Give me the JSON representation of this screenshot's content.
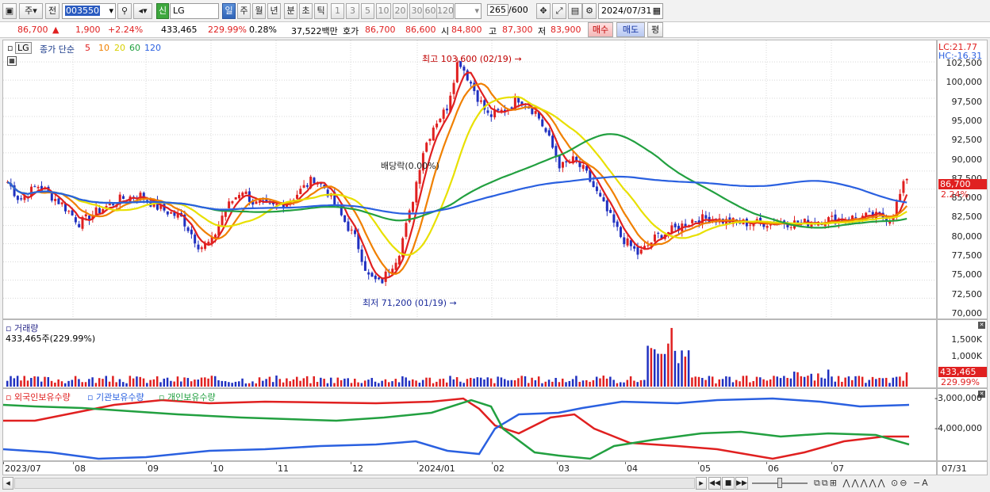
{
  "toolbar": {
    "period_label": "주",
    "prev_label": "전",
    "code_value": "003550",
    "stock_badge": "신",
    "name_value": "LG",
    "periods": [
      "일",
      "주",
      "월",
      "년",
      "분",
      "초",
      "틱"
    ],
    "counts": [
      "1",
      "3",
      "5",
      "10",
      "20",
      "30",
      "60",
      "120"
    ],
    "count_value": "265",
    "count_total": "/600",
    "date_value": "2024/07/31"
  },
  "info": {
    "price": "86,700",
    "change_arrow": "▲",
    "change": "1,900",
    "change_pct": "+2.24%",
    "volume": "433,465",
    "volume_ratio": "229.99%",
    "turnover": "0.28%",
    "amount": "37,522백만",
    "ask_label": "호가",
    "ask": "86,700",
    "bid": "86,600",
    "open_label": "시",
    "open": "84,800",
    "high_label": "고",
    "high": "87,300",
    "low_label": "저",
    "low": "83,900",
    "buy_btn": "매수",
    "sell_btn": "매도",
    "eval_btn": "평"
  },
  "price_panel": {
    "tag": "LG",
    "legend_title": "종가 단순",
    "ma_periods": [
      "5",
      "10",
      "20",
      "60",
      "120"
    ],
    "ma_colors": [
      "#e02020",
      "#f08000",
      "#e8e000",
      "#22a040",
      "#2a60e0"
    ],
    "lc": "LC:21.77",
    "hc": "HC:-16.31",
    "last_price_tag": "86,700",
    "last_pct_tag": "2.24%",
    "annot_high": "최고 103,600 (02/19)",
    "annot_low": "최저 71,200 (01/19)",
    "annot_div": "배당락(0.00%)",
    "y_ticks": [
      "102,500",
      "100,000",
      "97,500",
      "95,000",
      "92,500",
      "90,000",
      "87,500",
      "85,000",
      "82,500",
      "80,000",
      "77,500",
      "75,000",
      "72,500",
      "70,000"
    ]
  },
  "volume_panel": {
    "title": "거래량",
    "value": "433,465주(229.99%)",
    "y_ticks": [
      "1,500K",
      "1,000K"
    ],
    "last_tag": "433,465",
    "last_pct": "229.99%"
  },
  "holdings_panel": {
    "legends": [
      "외국인보유수량",
      "기관보유수량",
      "개인보유수량"
    ],
    "legend_colors": [
      "#e02020",
      "#2a60e0",
      "#22a040"
    ],
    "y_ticks": [
      "-3,000,000",
      "-4,000,000"
    ]
  },
  "x_axis": {
    "labels": [
      "2023/07",
      "08",
      "09",
      "10",
      "11",
      "12",
      "2024/01",
      "02",
      "03",
      "04",
      "05",
      "06",
      "07"
    ],
    "right_label": "07/31"
  },
  "colors": {
    "up": "#e02020",
    "down": "#2030c0",
    "volume_up": "#e02020",
    "volume_down": "#2030c0"
  }
}
